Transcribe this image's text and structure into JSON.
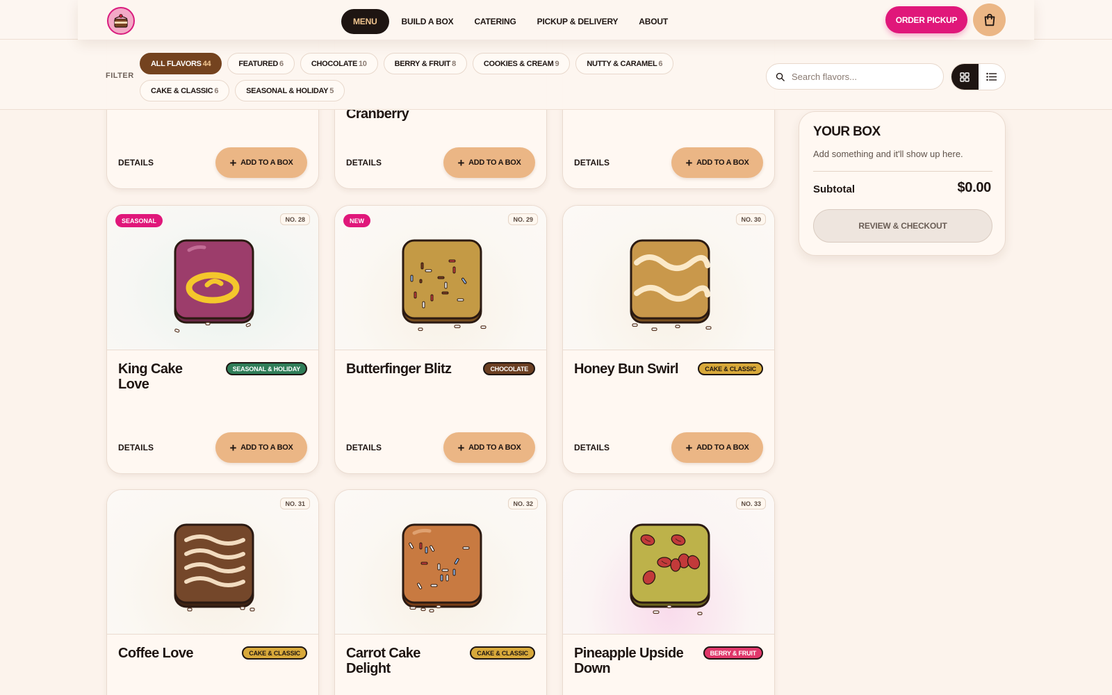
{
  "header": {
    "nav": [
      "MENU",
      "BUILD A BOX",
      "CATERING",
      "PICKUP & DELIVERY",
      "ABOUT"
    ],
    "order_button": "ORDER PICKUP",
    "cart_icon": "shopping-bag-icon"
  },
  "filter": {
    "label": "FILTER",
    "chips": [
      {
        "label": "ALL FLAVORS",
        "count": "44",
        "active": true
      },
      {
        "label": "FEATURED",
        "count": "6"
      },
      {
        "label": "CHOCOLATE",
        "count": "10"
      },
      {
        "label": "BERRY & FRUIT",
        "count": "8"
      },
      {
        "label": "COOKIES & CREAM",
        "count": "9"
      },
      {
        "label": "NUTTY & CARAMEL",
        "count": "6"
      },
      {
        "label": "CAKE & CLASSIC",
        "count": "6"
      },
      {
        "label": "SEASONAL & HOLIDAY",
        "count": "5"
      }
    ],
    "search_placeholder": "Search flavors...",
    "view": "grid"
  },
  "products_partial": [
    {
      "name": "",
      "details": "DETAILS",
      "add": "ADD TO A BOX"
    },
    {
      "name": "Cranberry",
      "details": "DETAILS",
      "add": "ADD TO A BOX"
    },
    {
      "name": "",
      "details": "DETAILS",
      "add": "ADD TO A BOX"
    }
  ],
  "products": [
    {
      "no": "NO. 28",
      "flag": "SEASONAL",
      "name": "King Cake Love",
      "category": "SEASONAL & HOLIDAY",
      "cat_style": "seasonal",
      "details": "DETAILS",
      "add": "ADD TO A BOX",
      "color": "#9c3d6b"
    },
    {
      "no": "NO. 29",
      "flag": "NEW",
      "name": "Butterfinger Blitz",
      "category": "CHOCOLATE",
      "cat_style": "chocolate",
      "details": "DETAILS",
      "add": "ADD TO A BOX",
      "color": "#c49a45"
    },
    {
      "no": "NO. 30",
      "flag": "",
      "name": "Honey Bun Swirl",
      "category": "CAKE & CLASSIC",
      "cat_style": "cake",
      "details": "DETAILS",
      "add": "ADD TO A BOX",
      "color": "#c9984b"
    },
    {
      "no": "NO. 31",
      "flag": "",
      "name": "Coffee Love",
      "category": "CAKE & CLASSIC",
      "cat_style": "cake",
      "color": "#74472a"
    },
    {
      "no": "NO. 32",
      "flag": "",
      "name": "Carrot Cake Delight",
      "category": "CAKE & CLASSIC",
      "cat_style": "cake",
      "color": "#c87a41"
    },
    {
      "no": "NO. 33",
      "flag": "",
      "name": "Pineapple Upside Down",
      "category": "BERRY & FRUIT",
      "cat_style": "berry",
      "color": "#bdb24a"
    }
  ],
  "box": {
    "title": "YOUR BOX",
    "empty_message": "Add something and it'll show up here.",
    "subtotal_label": "Subtotal",
    "subtotal_value": "$0.00",
    "checkout_label": "REVIEW & CHECKOUT"
  },
  "colors": {
    "accent_pink": "#e0177a",
    "chip_active": "#74431f",
    "add_button": "#ebb685",
    "background": "#fcf3ec"
  }
}
